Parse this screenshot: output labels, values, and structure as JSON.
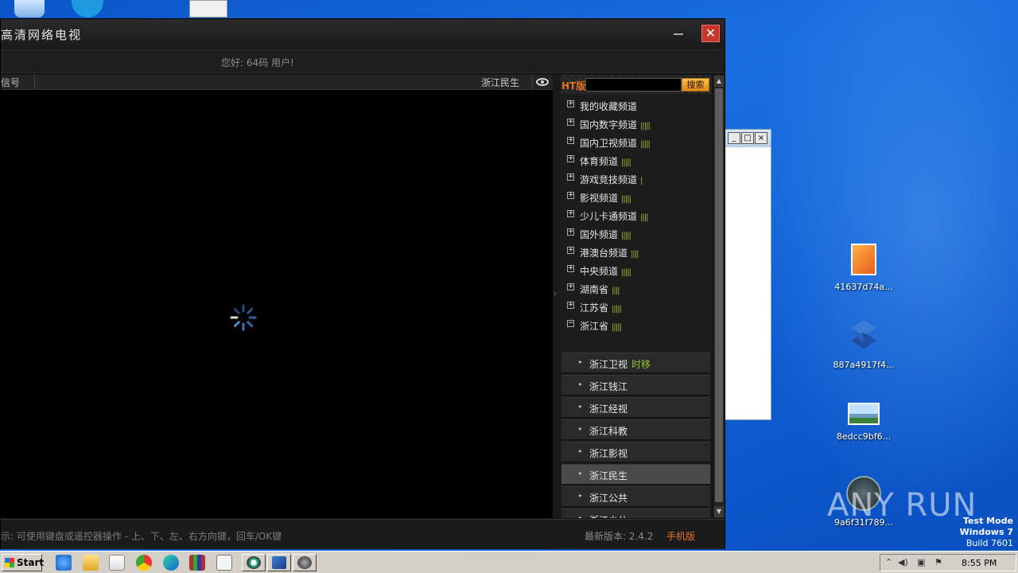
{
  "window": {
    "title": "高清网络电视",
    "greeting": "您好: 64码 用户!",
    "minimize_label": "–",
    "close_label": "✕"
  },
  "video_header": {
    "left_label": "信号",
    "current_channel": "浙江民生"
  },
  "sidebar": {
    "ht_label": "HT版",
    "search_placeholder": "",
    "search_button": "搜索",
    "categories": [
      {
        "label": "我的收藏频道",
        "bars": "",
        "expanded": false
      },
      {
        "label": "国内数字频道",
        "bars": "|||||",
        "expanded": false
      },
      {
        "label": "国内卫视频道",
        "bars": "|||||",
        "expanded": false
      },
      {
        "label": "体育频道",
        "bars": "|||||",
        "expanded": false
      },
      {
        "label": "游戏竞技频道",
        "bars": "|",
        "expanded": false
      },
      {
        "label": "影视频道",
        "bars": "|||||",
        "expanded": false
      },
      {
        "label": "少儿卡通频道",
        "bars": "||||",
        "expanded": false
      },
      {
        "label": "国外频道",
        "bars": "|||||",
        "expanded": false
      },
      {
        "label": "港澳台频道",
        "bars": "||||",
        "expanded": false
      },
      {
        "label": "中央频道",
        "bars": "|||||",
        "expanded": false
      },
      {
        "label": "湖南省",
        "bars": "||||",
        "expanded": false
      },
      {
        "label": "江苏省",
        "bars": "|||||",
        "expanded": false
      },
      {
        "label": "浙江省",
        "bars": "|||||",
        "expanded": true
      }
    ],
    "zhejiang_channels": [
      {
        "label": "浙江卫视",
        "extra": "时移",
        "active": false
      },
      {
        "label": "浙江钱江",
        "extra": "",
        "active": false
      },
      {
        "label": "浙江经视",
        "extra": "",
        "active": false
      },
      {
        "label": "浙江科教",
        "extra": "",
        "active": false
      },
      {
        "label": "浙江影视",
        "extra": "",
        "active": false
      },
      {
        "label": "浙江民生",
        "extra": "",
        "active": true
      },
      {
        "label": "浙江公共",
        "extra": "",
        "active": false
      },
      {
        "label": "浙江少儿",
        "extra": "",
        "active": false
      }
    ]
  },
  "statusbar": {
    "tip": "示: 可使用键盘或遥控器操作 - 上、下、左、右方向键，回车/OK键",
    "version_label": "最新版本: 2.4.2",
    "mobile_link": "手机版"
  },
  "desktop": {
    "icons": [
      {
        "label": "41637d74a...",
        "icon": "orange-file-icon"
      },
      {
        "label": "887a4917f4...",
        "icon": "blue-cube-icon"
      },
      {
        "label": "8edcc9bf6...",
        "icon": "image-file-icon"
      },
      {
        "label": "9a6f31f789...",
        "icon": "media-app-icon"
      }
    ],
    "watermark": "ANY RUN",
    "test_mode": [
      "Test Mode",
      "Windows 7",
      "Build 7601"
    ]
  },
  "taskbar": {
    "start_label": "Start",
    "clock": "8:55 PM"
  }
}
